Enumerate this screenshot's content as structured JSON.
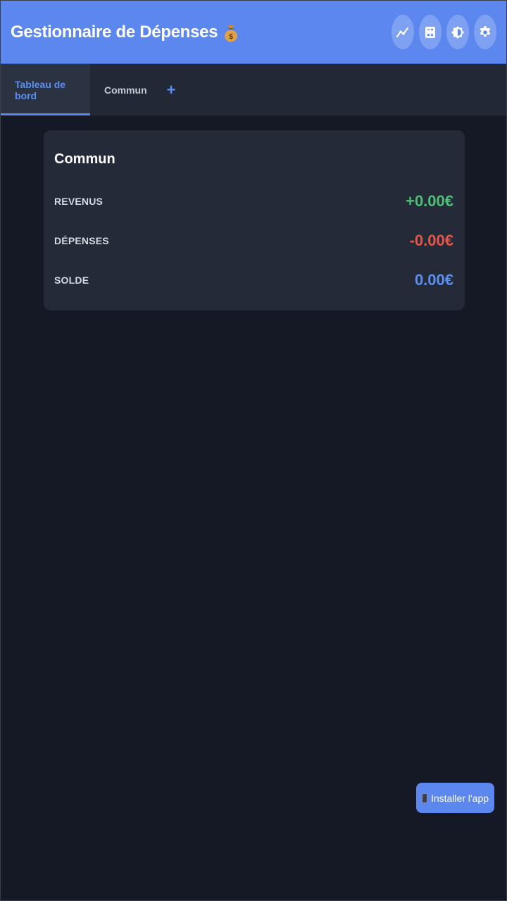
{
  "header": {
    "title": "Gestionnaire de Dépenses",
    "title_icon": "money-bag-icon",
    "actions": [
      {
        "name": "stats-button",
        "icon": "trend-chart-icon"
      },
      {
        "name": "calculator-button",
        "icon": "calculator-icon"
      },
      {
        "name": "theme-toggle-button",
        "icon": "brightness-icon"
      },
      {
        "name": "settings-button",
        "icon": "gear-icon"
      }
    ]
  },
  "tabs": {
    "items": [
      {
        "label": "Tableau de bord",
        "active": true
      },
      {
        "label": "Commun",
        "active": false
      }
    ],
    "add_label": "+"
  },
  "summary_card": {
    "title": "Commun",
    "rows": [
      {
        "label": "REVENUS",
        "value": "+0.00€",
        "color": "#4fbf78"
      },
      {
        "label": "DÉPENSES",
        "value": "-0.00€",
        "color": "#e5564b"
      },
      {
        "label": "SOLDE",
        "value": "0.00€",
        "color": "#5b8fef"
      }
    ]
  },
  "install_button": {
    "icon": "phone-icon",
    "label": "Installer l'app"
  },
  "colors": {
    "accent": "#5b87ee",
    "background": "#151925",
    "surface": "#242a37"
  }
}
